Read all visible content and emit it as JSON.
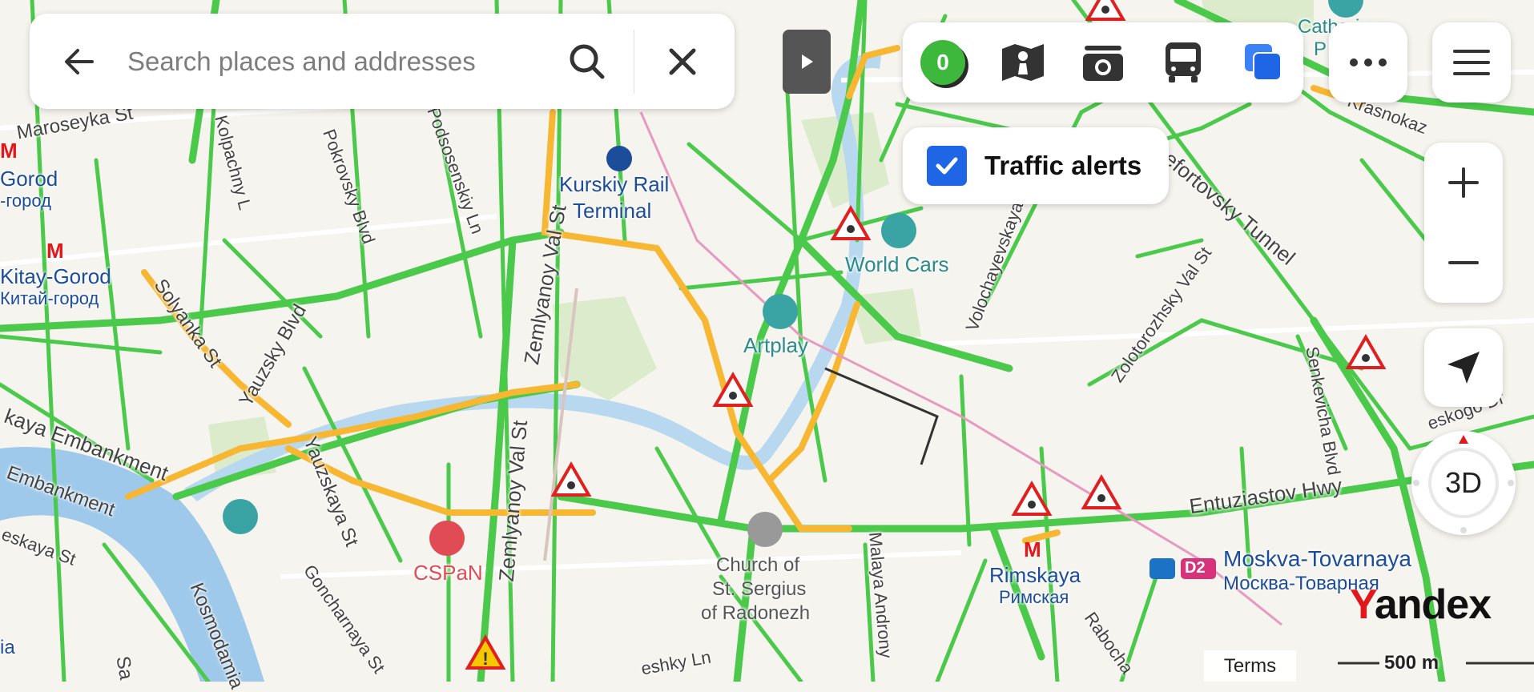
{
  "search": {
    "placeholder": "Search places and addresses"
  },
  "layers": {
    "traffic_score": "0",
    "items": [
      "traffic-icon",
      "panorama-icon",
      "camera-icon",
      "transit-icon",
      "layers-icon"
    ]
  },
  "traffic_alerts": {
    "label": "Traffic alerts",
    "checked": true
  },
  "compass": {
    "label": "3D"
  },
  "map_labels": {
    "maroseyka": "Maroseyka St",
    "gorod": "Gorod",
    "gorod_ru": "-город",
    "kitay_gorod": "Kitay-Gorod",
    "kitay_gorod_ru": "Китай-город",
    "kolpachny": "Kolpachny L",
    "pokrovsky": "Pokrovsky Blvd",
    "podsosensky": "Podsosenskiy Ln",
    "zemlyanoy_top": "Zemlyanoy Val St",
    "zemlyanoy_bottom": "Zemlyanoy Val St",
    "kursky_1": "Kurskiy Rail",
    "kursky_2": "Terminal",
    "world_cars": "World Cars",
    "artplay": "Artplay",
    "lefortovsky": "Lefortovsky Tunnel",
    "volochaevskaya": "Volochayevskaya S",
    "zolotorozhsky": "Zolotorozhsky Val St",
    "senkevicha": "Senkevicha Blvd",
    "krasnokaz": "Krasnokaz",
    "catherine_1": "Catherine",
    "catherine_2": "P",
    "solyanka": "Solyanka St",
    "yauzsky_blvd": "Yauzsky Blvd",
    "embankment_1": "kaya Embankment",
    "embankment_2": "Embankment",
    "eskaya": "eskaya St",
    "yauzskaya": "Yauzskaya St",
    "goncharnaya": "Goncharnaya St",
    "kosmodam": "Kosmodamia",
    "cspan": "CSPaN",
    "church_1": "Church of",
    "church_2": "St. Sergius",
    "church_3": "of Radonezh",
    "malaya_andronyevskaya": "Malaya Androny",
    "rimskaya": "Rimskaya",
    "rimskaya_ru": "Римская",
    "entuziastov": "Entuziastov Hwy",
    "moskva_tovarnaya": "Moskva-Tovarnaya",
    "moskva_tovarnaya_ru": "Москва-Товарная",
    "d2": "D2",
    "rabocha": "Rabocha",
    "eskogo": "eskogo Dr",
    "esky_ln": "eshky Ln",
    "ia": "ia",
    "sa": "Sa"
  },
  "footer": {
    "terms": "Terms",
    "scale": "500 m",
    "logo_y": "Y",
    "logo_rest": "andex"
  },
  "colors": {
    "traffic_free": "#4ac94a",
    "traffic_slow": "#f7b733",
    "river": "#9fc9ea",
    "accent": "#1e66e6",
    "metro": "#e3161b"
  }
}
